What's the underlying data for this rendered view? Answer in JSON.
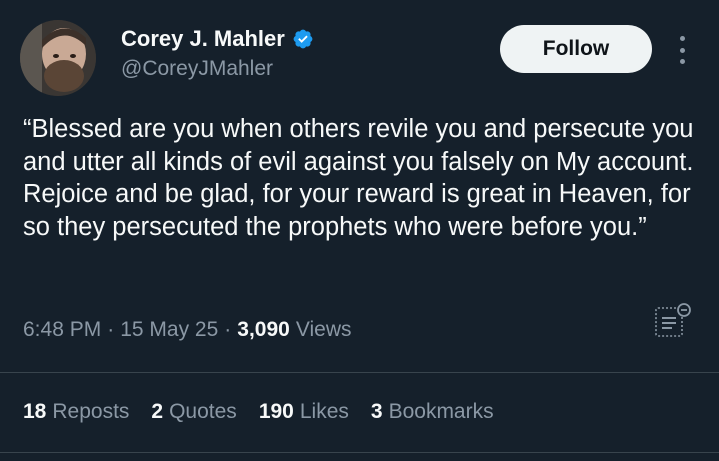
{
  "author": {
    "name": "Corey J. Mahler",
    "handle": "@CoreyJMahler",
    "verified_color": "#1d9bf0"
  },
  "follow_button": {
    "label": "Follow"
  },
  "tweet": {
    "text": "“Blessed are you when others revile you and persecute you and utter all kinds of evil against you falsely on My account. Rejoice and be glad, for your reward is great in Heaven, for so they persecuted the prophets who were before you.”"
  },
  "meta": {
    "time": "6:48 PM",
    "date": "15 May 25",
    "separator": "·",
    "views_count": "3,090",
    "views_label": "Views"
  },
  "stats": {
    "reposts": {
      "count": "18",
      "label": "Reposts"
    },
    "quotes": {
      "count": "2",
      "label": "Quotes"
    },
    "likes": {
      "count": "190",
      "label": "Likes"
    },
    "bookmarks": {
      "count": "3",
      "label": "Bookmarks"
    }
  },
  "icons": {
    "more": "more-options-icon",
    "verified": "verified-badge-icon",
    "translate": "translate-icon"
  },
  "colors": {
    "background": "#15202b",
    "text": "#f7f9f9",
    "muted": "#8b98a5",
    "divider": "#38444d",
    "button_bg": "#eff3f4"
  }
}
